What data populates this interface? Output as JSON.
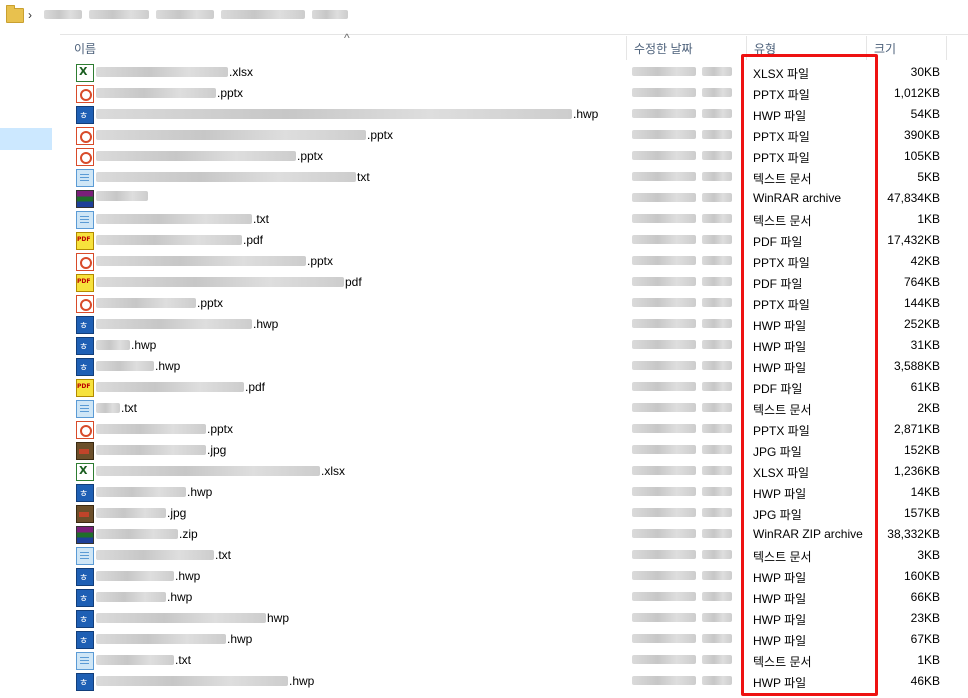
{
  "header": {
    "name": "이름",
    "modified": "수정한 날짜",
    "type": "유형",
    "size": "크기"
  },
  "colors": {
    "highlight_box": "#ee1111",
    "header_text": "#4c607a",
    "nav_selection": "#cce8ff"
  },
  "files": [
    {
      "icon": "xlsx-icon",
      "ext": ".xlsx",
      "type": "XLSX 파일",
      "size": "30KB"
    },
    {
      "icon": "pptx-icon",
      "ext": ".pptx",
      "type": "PPTX 파일",
      "size": "1,012KB"
    },
    {
      "icon": "hwp-icon",
      "ext": ".hwp",
      "type": "HWP 파일",
      "size": "54KB"
    },
    {
      "icon": "pptx-icon",
      "ext": ".pptx",
      "type": "PPTX 파일",
      "size": "390KB"
    },
    {
      "icon": "pptx-icon",
      "ext": ".pptx",
      "type": "PPTX 파일",
      "size": "105KB"
    },
    {
      "icon": "txt-icon",
      "ext": "txt",
      "type": "텍스트 문서",
      "size": "5KB"
    },
    {
      "icon": "rar-icon",
      "ext": "",
      "type": "WinRAR archive",
      "size": "47,834KB"
    },
    {
      "icon": "txt-icon",
      "ext": ".txt",
      "type": "텍스트 문서",
      "size": "1KB"
    },
    {
      "icon": "pdf-icon",
      "ext": ".pdf",
      "type": "PDF 파일",
      "size": "17,432KB"
    },
    {
      "icon": "pptx-icon",
      "ext": ".pptx",
      "type": "PPTX 파일",
      "size": "42KB"
    },
    {
      "icon": "pdf-icon",
      "ext": "pdf",
      "type": "PDF 파일",
      "size": "764KB"
    },
    {
      "icon": "pptx-icon",
      "ext": ".pptx",
      "type": "PPTX 파일",
      "size": "144KB"
    },
    {
      "icon": "hwp-icon",
      "ext": ".hwp",
      "type": "HWP 파일",
      "size": "252KB"
    },
    {
      "icon": "hwp-icon",
      "ext": ".hwp",
      "type": "HWP 파일",
      "size": "31KB"
    },
    {
      "icon": "hwp-icon",
      "ext": ".hwp",
      "type": "HWP 파일",
      "size": "3,588KB"
    },
    {
      "icon": "pdf-icon",
      "ext": ".pdf",
      "type": "PDF 파일",
      "size": "61KB"
    },
    {
      "icon": "txt-icon",
      "ext": ".txt",
      "type": "텍스트 문서",
      "size": "2KB"
    },
    {
      "icon": "pptx-icon",
      "ext": ".pptx",
      "type": "PPTX 파일",
      "size": "2,871KB"
    },
    {
      "icon": "jpg-icon",
      "ext": ".jpg",
      "type": "JPG 파일",
      "size": "152KB"
    },
    {
      "icon": "xlsx-icon",
      "ext": ".xlsx",
      "type": "XLSX 파일",
      "size": "1,236KB"
    },
    {
      "icon": "hwp-icon",
      "ext": ".hwp",
      "type": "HWP 파일",
      "size": "14KB"
    },
    {
      "icon": "jpg-icon",
      "ext": ".jpg",
      "type": "JPG 파일",
      "size": "157KB"
    },
    {
      "icon": "rar-icon",
      "ext": ".zip",
      "type": "WinRAR ZIP archive",
      "size": "38,332KB"
    },
    {
      "icon": "txt-icon",
      "ext": ".txt",
      "type": "텍스트 문서",
      "size": "3KB"
    },
    {
      "icon": "hwp-icon",
      "ext": ".hwp",
      "type": "HWP 파일",
      "size": "160KB"
    },
    {
      "icon": "hwp-icon",
      "ext": ".hwp",
      "type": "HWP 파일",
      "size": "66KB"
    },
    {
      "icon": "hwp-icon",
      "ext": "hwp",
      "type": "HWP 파일",
      "size": "23KB"
    },
    {
      "icon": "hwp-icon",
      "ext": ".hwp",
      "type": "HWP 파일",
      "size": "67KB"
    },
    {
      "icon": "txt-icon",
      "ext": ".txt",
      "type": "텍스트 문서",
      "size": "1KB"
    },
    {
      "icon": "hwp-icon",
      "ext": ".hwp",
      "type": "HWP 파일",
      "size": "46KB"
    }
  ]
}
